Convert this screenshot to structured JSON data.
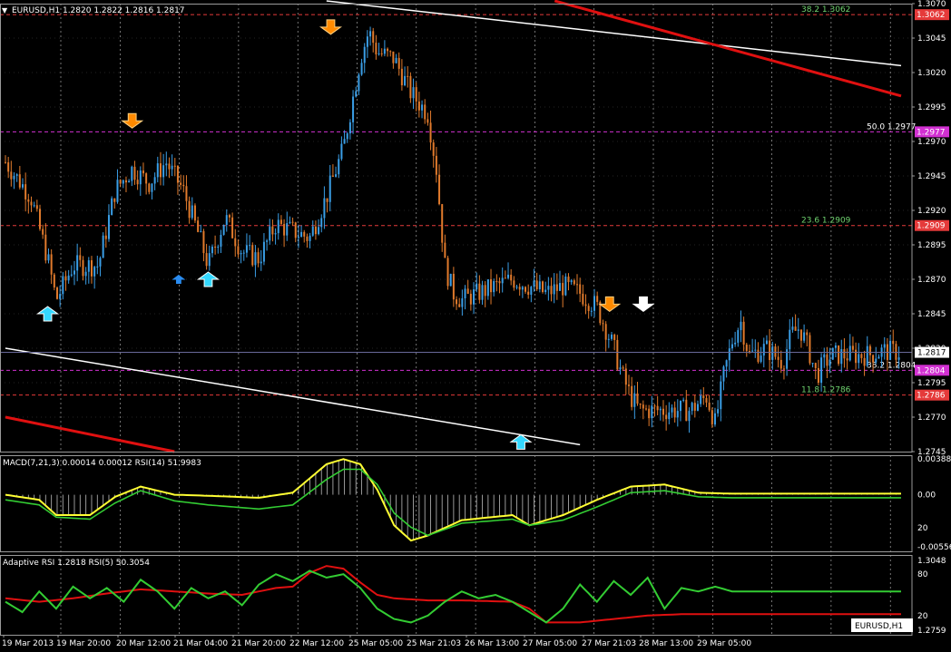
{
  "window": {
    "title": "EURUSD,H1",
    "main_header": "EURUSD,H1  1.2820 1.2822 1.2816 1.2817",
    "macd_header": "MACD(7,21,3) 0.00014 0.00012  RSI(14) 51.9983",
    "arsi_header": "Adaptive RSI 1.2818  RSI(5) 50.3054",
    "corner_tag": "EURUSD,H1"
  },
  "colors": {
    "background": "#000000",
    "bull": "#3a9ee6",
    "bear": "#e07a2c",
    "grid": "#ffffff",
    "axis": "#9a9a9a",
    "fib_line": "#e53a3a",
    "fib_magenta": "#d230d2",
    "fib_text": "#6fd36f",
    "macd_line": "#ffff33",
    "signal_line": "#33cc33",
    "hist": "#a8a8a8",
    "arsi_green": "#33cc33",
    "arsi_red": "#e01010",
    "trend_white": "#ffffff",
    "trend_red": "#e01010",
    "up_arrow": "#33d8ff",
    "down_arrow": "#ff8a00",
    "price_box": "#e53a3a",
    "price_box_magenta": "#d230d2"
  },
  "chart_data": {
    "type": "line",
    "symbol": "EURUSD",
    "timeframe": "H1",
    "ylim": [
      1.2745,
      1.307
    ],
    "y_ticks": [
      "1.3070",
      "1.3045",
      "1.3020",
      "1.2995",
      "1.2970",
      "1.2945",
      "1.2920",
      "1.2895",
      "1.2870",
      "1.2845",
      "1.2820",
      "1.2795",
      "1.2770",
      "1.2745"
    ],
    "x_labels": [
      "19 Mar 2013",
      "19 Mar 20:00",
      "20 Mar 12:00",
      "21 Mar 04:00",
      "21 Mar 20:00",
      "22 Mar 12:00",
      "25 Mar 05:00",
      "25 Mar 21:03",
      "26 Mar 13:00",
      "27 Mar 05:00",
      "27 Mar 21:03",
      "28 Mar 13:00",
      "29 Mar 05:00"
    ],
    "ohlc_last": {
      "open": 1.282,
      "high": 1.2822,
      "low": 1.2816,
      "close": 1.2817
    },
    "current_price": "1.2817",
    "close_path": [
      [
        0,
        1.2955
      ],
      [
        3,
        1.293
      ],
      [
        5,
        1.2885
      ],
      [
        6,
        1.2855
      ],
      [
        8,
        1.288
      ],
      [
        11,
        1.288
      ],
      [
        13,
        1.2935
      ],
      [
        15,
        1.295
      ],
      [
        17,
        1.294
      ],
      [
        19,
        1.2955
      ],
      [
        21,
        1.2935
      ],
      [
        23,
        1.29
      ],
      [
        24,
        1.288
      ],
      [
        26,
        1.2915
      ],
      [
        28,
        1.289
      ],
      [
        30,
        1.2885
      ],
      [
        32,
        1.291
      ],
      [
        34,
        1.2905
      ],
      [
        36,
        1.29
      ],
      [
        38,
        1.293
      ],
      [
        40,
        1.2965
      ],
      [
        42,
        1.303
      ],
      [
        43,
        1.305
      ],
      [
        44,
        1.3035
      ],
      [
        46,
        1.303
      ],
      [
        48,
        1.3005
      ],
      [
        50,
        1.299
      ],
      [
        51,
        1.295
      ],
      [
        52,
        1.288
      ],
      [
        53,
        1.286
      ],
      [
        54,
        1.2855
      ],
      [
        56,
        1.286
      ],
      [
        58,
        1.2865
      ],
      [
        60,
        1.287
      ],
      [
        62,
        1.2865
      ],
      [
        64,
        1.286
      ],
      [
        66,
        1.2865
      ],
      [
        68,
        1.286
      ],
      [
        70,
        1.285
      ],
      [
        72,
        1.282
      ],
      [
        73,
        1.28
      ],
      [
        74,
        1.2785
      ],
      [
        75,
        1.2775
      ],
      [
        77,
        1.2775
      ],
      [
        79,
        1.2775
      ],
      [
        81,
        1.2775
      ],
      [
        83,
        1.2785
      ],
      [
        84,
        1.2765
      ],
      [
        85,
        1.28
      ],
      [
        86,
        1.2825
      ],
      [
        87,
        1.284
      ],
      [
        88,
        1.2815
      ],
      [
        90,
        1.282
      ],
      [
        92,
        1.281
      ],
      [
        93,
        1.283
      ],
      [
        94,
        1.2835
      ],
      [
        95,
        1.282
      ],
      [
        96,
        1.28
      ],
      [
        97,
        1.281
      ],
      [
        98,
        1.2815
      ],
      [
        100,
        1.2815
      ],
      [
        102,
        1.2815
      ],
      [
        104,
        1.2818
      ],
      [
        106,
        1.2817
      ]
    ],
    "x_count": 106,
    "fibonacci": [
      {
        "level": "38.2",
        "price": 1.3062,
        "text": "38.2  1.3062",
        "box": "1.3062",
        "style": "red"
      },
      {
        "level": "50.0",
        "price": 1.2977,
        "text": "50.0  1.2977",
        "box": "1.2977",
        "style": "magenta"
      },
      {
        "level": "23.6",
        "price": 1.2909,
        "text": "23.6  1.2909",
        "box": "1.2909",
        "style": "red"
      },
      {
        "level": "38.2",
        "price": 1.2804,
        "text": "38.2  1.2804",
        "box": "1.2804",
        "style": "magenta"
      },
      {
        "level": "11.8",
        "price": 1.2786,
        "text": "11.8  1.2786",
        "box": "1.2786",
        "style": "red"
      }
    ],
    "trend_lines": [
      {
        "color": "white",
        "from": [
          38,
          1.3072
        ],
        "to": [
          106,
          1.3025
        ]
      },
      {
        "color": "red",
        "from": [
          65,
          1.3072
        ],
        "to": [
          106,
          1.3003
        ]
      },
      {
        "color": "white",
        "from": [
          0,
          1.282
        ],
        "to": [
          68,
          1.275
        ]
      },
      {
        "color": "red",
        "from": [
          0,
          1.277
        ],
        "to": [
          20,
          1.2745
        ]
      }
    ],
    "arrows": [
      {
        "dir": "up",
        "x": 5,
        "price": 1.2845,
        "size": "big",
        "color": "up"
      },
      {
        "dir": "down",
        "x": 15,
        "price": 1.2985,
        "size": "big",
        "color": "down"
      },
      {
        "dir": "up",
        "x": 20.5,
        "price": 1.287,
        "size": "small",
        "color": "up_dark"
      },
      {
        "dir": "up",
        "x": 24,
        "price": 1.287,
        "size": "big",
        "color": "up"
      },
      {
        "dir": "down",
        "x": 38.5,
        "price": 1.3053,
        "size": "big",
        "color": "down"
      },
      {
        "dir": "up",
        "x": 61,
        "price": 1.2752,
        "size": "big",
        "color": "up"
      },
      {
        "dir": "down",
        "x": 71.5,
        "price": 1.2852,
        "size": "big",
        "color": "down"
      },
      {
        "dir": "down",
        "x": 75.5,
        "price": 1.2852,
        "size": "big",
        "color": "white"
      }
    ],
    "macd": {
      "ylim": [
        -0.00556,
        0.00388
      ],
      "y_ticks": [
        "0.00388",
        "0.00",
        "20",
        "-0.00556"
      ],
      "line": [
        [
          0,
          0.0
        ],
        [
          4,
          -0.0005
        ],
        [
          6,
          -0.002
        ],
        [
          10,
          -0.002
        ],
        [
          13,
          -0.0002
        ],
        [
          16,
          0.0008
        ],
        [
          20,
          0.0
        ],
        [
          24,
          -0.0001
        ],
        [
          30,
          -0.0003
        ],
        [
          34,
          0.0002
        ],
        [
          38,
          0.003
        ],
        [
          40,
          0.0035
        ],
        [
          42,
          0.003
        ],
        [
          44,
          0.0005
        ],
        [
          46,
          -0.003
        ],
        [
          48,
          -0.0045
        ],
        [
          50,
          -0.004
        ],
        [
          54,
          -0.0025
        ],
        [
          60,
          -0.002
        ],
        [
          62,
          -0.003
        ],
        [
          66,
          -0.002
        ],
        [
          70,
          -0.0005
        ],
        [
          74,
          0.0008
        ],
        [
          78,
          0.001
        ],
        [
          82,
          0.0002
        ],
        [
          86,
          0.0001
        ]
      ],
      "signal": [
        [
          0,
          -0.0005
        ],
        [
          4,
          -0.001
        ],
        [
          6,
          -0.0022
        ],
        [
          10,
          -0.0024
        ],
        [
          13,
          -0.0008
        ],
        [
          16,
          0.0004
        ],
        [
          20,
          -0.0006
        ],
        [
          24,
          -0.001
        ],
        [
          30,
          -0.0014
        ],
        [
          34,
          -0.001
        ],
        [
          38,
          0.0015
        ],
        [
          40,
          0.0025
        ],
        [
          42,
          0.0025
        ],
        [
          44,
          0.001
        ],
        [
          46,
          -0.0018
        ],
        [
          48,
          -0.0032
        ],
        [
          50,
          -0.004
        ],
        [
          54,
          -0.0028
        ],
        [
          60,
          -0.0024
        ],
        [
          62,
          -0.003
        ],
        [
          66,
          -0.0025
        ],
        [
          70,
          -0.0012
        ],
        [
          74,
          0.0002
        ],
        [
          78,
          0.0004
        ],
        [
          82,
          -0.0002
        ],
        [
          86,
          -0.0003
        ]
      ]
    },
    "adaptive_rsi": {
      "ylim": [
        0,
        100
      ],
      "y_ticks": [
        "1.3048",
        "80",
        "20",
        "1.2759"
      ],
      "rsi": [
        [
          0,
          40
        ],
        [
          2,
          25
        ],
        [
          4,
          55
        ],
        [
          6,
          30
        ],
        [
          8,
          62
        ],
        [
          10,
          45
        ],
        [
          12,
          60
        ],
        [
          14,
          40
        ],
        [
          16,
          72
        ],
        [
          18,
          55
        ],
        [
          20,
          30
        ],
        [
          22,
          60
        ],
        [
          24,
          45
        ],
        [
          26,
          55
        ],
        [
          28,
          35
        ],
        [
          30,
          65
        ],
        [
          32,
          80
        ],
        [
          34,
          70
        ],
        [
          36,
          85
        ],
        [
          38,
          75
        ],
        [
          40,
          80
        ],
        [
          42,
          60
        ],
        [
          44,
          30
        ],
        [
          46,
          15
        ],
        [
          48,
          10
        ],
        [
          50,
          20
        ],
        [
          52,
          40
        ],
        [
          54,
          55
        ],
        [
          56,
          45
        ],
        [
          58,
          50
        ],
        [
          60,
          40
        ],
        [
          62,
          25
        ],
        [
          64,
          10
        ],
        [
          66,
          30
        ],
        [
          68,
          65
        ],
        [
          70,
          40
        ],
        [
          72,
          70
        ],
        [
          74,
          50
        ],
        [
          76,
          75
        ],
        [
          78,
          30
        ],
        [
          80,
          60
        ],
        [
          82,
          55
        ],
        [
          84,
          62
        ],
        [
          86,
          55
        ]
      ],
      "signal": [
        [
          0,
          45
        ],
        [
          4,
          40
        ],
        [
          8,
          45
        ],
        [
          12,
          52
        ],
        [
          16,
          58
        ],
        [
          20,
          55
        ],
        [
          24,
          52
        ],
        [
          28,
          50
        ],
        [
          32,
          60
        ],
        [
          34,
          62
        ],
        [
          36,
          82
        ],
        [
          38,
          92
        ],
        [
          40,
          88
        ],
        [
          42,
          68
        ],
        [
          44,
          50
        ],
        [
          46,
          45
        ],
        [
          50,
          42
        ],
        [
          54,
          42
        ],
        [
          60,
          40
        ],
        [
          62,
          30
        ],
        [
          64,
          10
        ],
        [
          68,
          10
        ],
        [
          72,
          15
        ],
        [
          76,
          20
        ],
        [
          80,
          22
        ],
        [
          86,
          22
        ]
      ]
    }
  }
}
